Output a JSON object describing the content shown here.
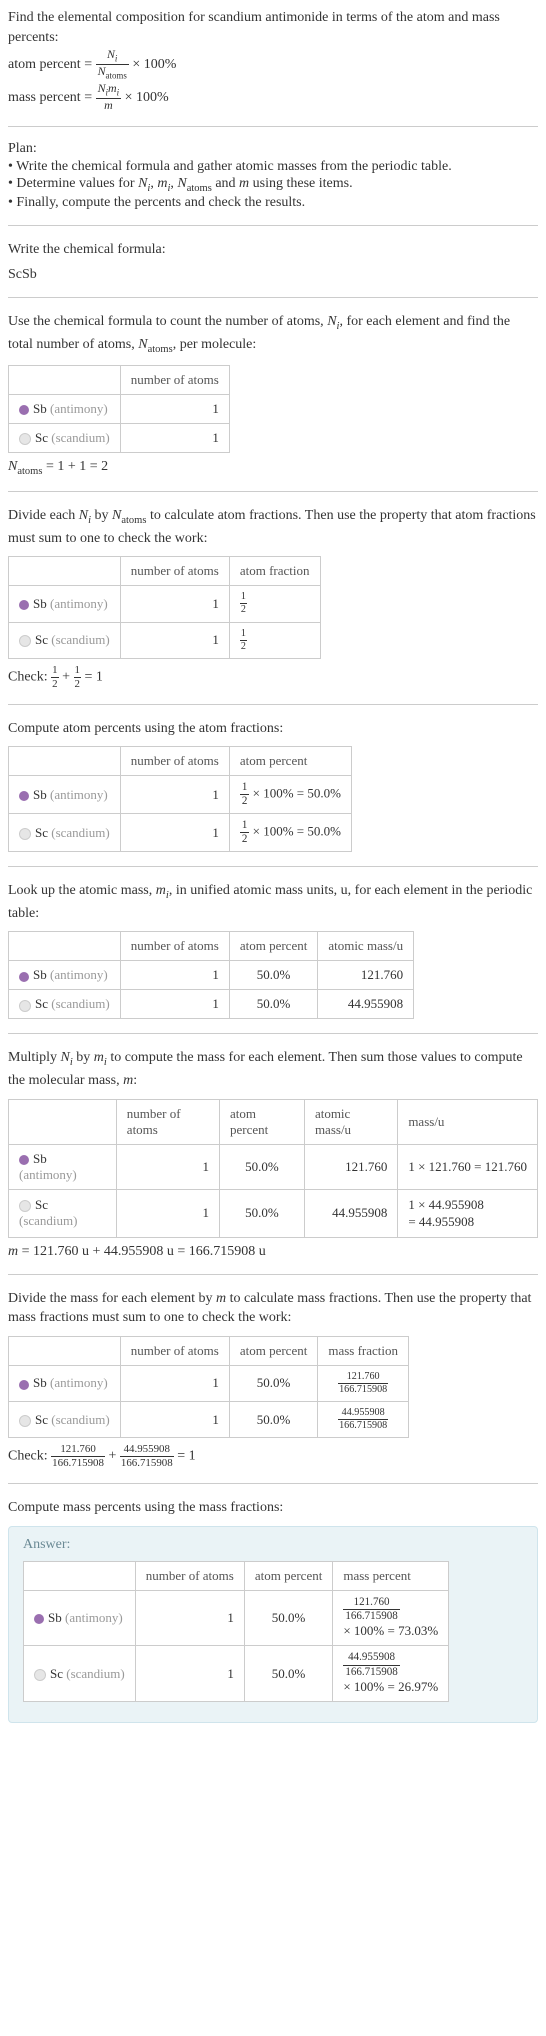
{
  "intro": {
    "line1": "Find the elemental composition for scandium antimonide in terms of the atom and mass percents:",
    "atom_percent_label": "atom percent ",
    "mass_percent_label": "mass percent "
  },
  "plan": {
    "title": "Plan:",
    "item1": "• Write the chemical formula and gather atomic masses from the periodic table.",
    "item2_a": "• Determine values for ",
    "item2_b": " using these items.",
    "item3": "• Finally, compute the percents and check the results."
  },
  "sec_formula": {
    "title": "Write the chemical formula:",
    "formula": "ScSb"
  },
  "sec_count": {
    "text_a": "Use the chemical formula to count the number of atoms, ",
    "text_b": ", for each element and find the total number of atoms, ",
    "text_c": ", per molecule:"
  },
  "headers": {
    "number_of_atoms": "number of atoms",
    "atom_fraction": "atom fraction",
    "atom_percent": "atom percent",
    "atomic_mass": "atomic mass/u",
    "mass_u": "mass/u",
    "mass_fraction": "mass fraction",
    "mass_percent": "mass percent"
  },
  "elements": {
    "sb": {
      "symbol": "Sb",
      "name": "(antimony)",
      "color": "#9a6fb0"
    },
    "sc": {
      "symbol": "Sc",
      "name": "(scandium)",
      "color": "#e6e6e6"
    }
  },
  "counts": {
    "sb": "1",
    "sc": "1",
    "total_expr_a": " = 1 + 1 = 2"
  },
  "sec_atomfrac": {
    "text": "Divide each Nᵢ by N_atoms to calculate atom fractions. Then use the property that atom fractions must sum to one to check the work:",
    "text_a": "Divide each ",
    "text_b": " by ",
    "text_c": " to calculate atom fractions. Then use the property that atom fractions must sum to one to check the work:"
  },
  "fractions": {
    "half_num": "1",
    "half_den": "2"
  },
  "check1": {
    "label": "Check: ",
    "result": " = 1"
  },
  "sec_atompct": {
    "text": "Compute atom percents using the atom fractions:",
    "pct": " × 100% = 50.0%"
  },
  "sec_mass_lookup": {
    "text_a": "Look up the atomic mass, ",
    "text_b": ", in unified atomic mass units, u, for each element in the periodic table:"
  },
  "atomic_mass": {
    "sb": "121.760",
    "sc": "44.955908"
  },
  "atom_percent": {
    "sb": "50.0%",
    "sc": "50.0%"
  },
  "sec_massmult": {
    "text_a": "Multiply ",
    "text_b": " by ",
    "text_c": " to compute the mass for each element. Then sum those values to compute the molecular mass, ",
    "text_d": ":"
  },
  "mass_calc": {
    "sb": "1 × 121.760 = 121.760",
    "sc_a": "1 × 44.955908",
    "sc_b": "= 44.955908"
  },
  "m_total": {
    "expr": " = 121.760 u + 44.955908 u = 166.715908 u"
  },
  "sec_massfrac": {
    "text_a": "Divide the mass for each element by ",
    "text_b": " to calculate mass fractions. Then use the property that mass fractions must sum to one to check the work:"
  },
  "massfrac": {
    "sb_num": "121.760",
    "sc_num": "44.955908",
    "den": "166.715908"
  },
  "check2": {
    "label": "Check: ",
    "plus": " + ",
    "result": " = 1"
  },
  "sec_masspct": {
    "text": "Compute mass percents using the mass fractions:"
  },
  "answer": {
    "label": "Answer:",
    "sb_pct": "× 100% = 73.03%",
    "sc_pct": "× 100% = 26.97%"
  },
  "chart_data": {
    "type": "table",
    "title": "Elemental composition of ScSb",
    "rows": [
      {
        "element": "Sb",
        "name": "antimony",
        "atoms": 1,
        "atom_percent": 50.0,
        "atomic_mass_u": 121.76,
        "mass_u": 121.76,
        "mass_fraction": 0.7303,
        "mass_percent": 73.03
      },
      {
        "element": "Sc",
        "name": "scandium",
        "atoms": 1,
        "atom_percent": 50.0,
        "atomic_mass_u": 44.955908,
        "mass_u": 44.955908,
        "mass_fraction": 0.2697,
        "mass_percent": 26.97
      }
    ],
    "molecular_mass_u": 166.715908
  }
}
